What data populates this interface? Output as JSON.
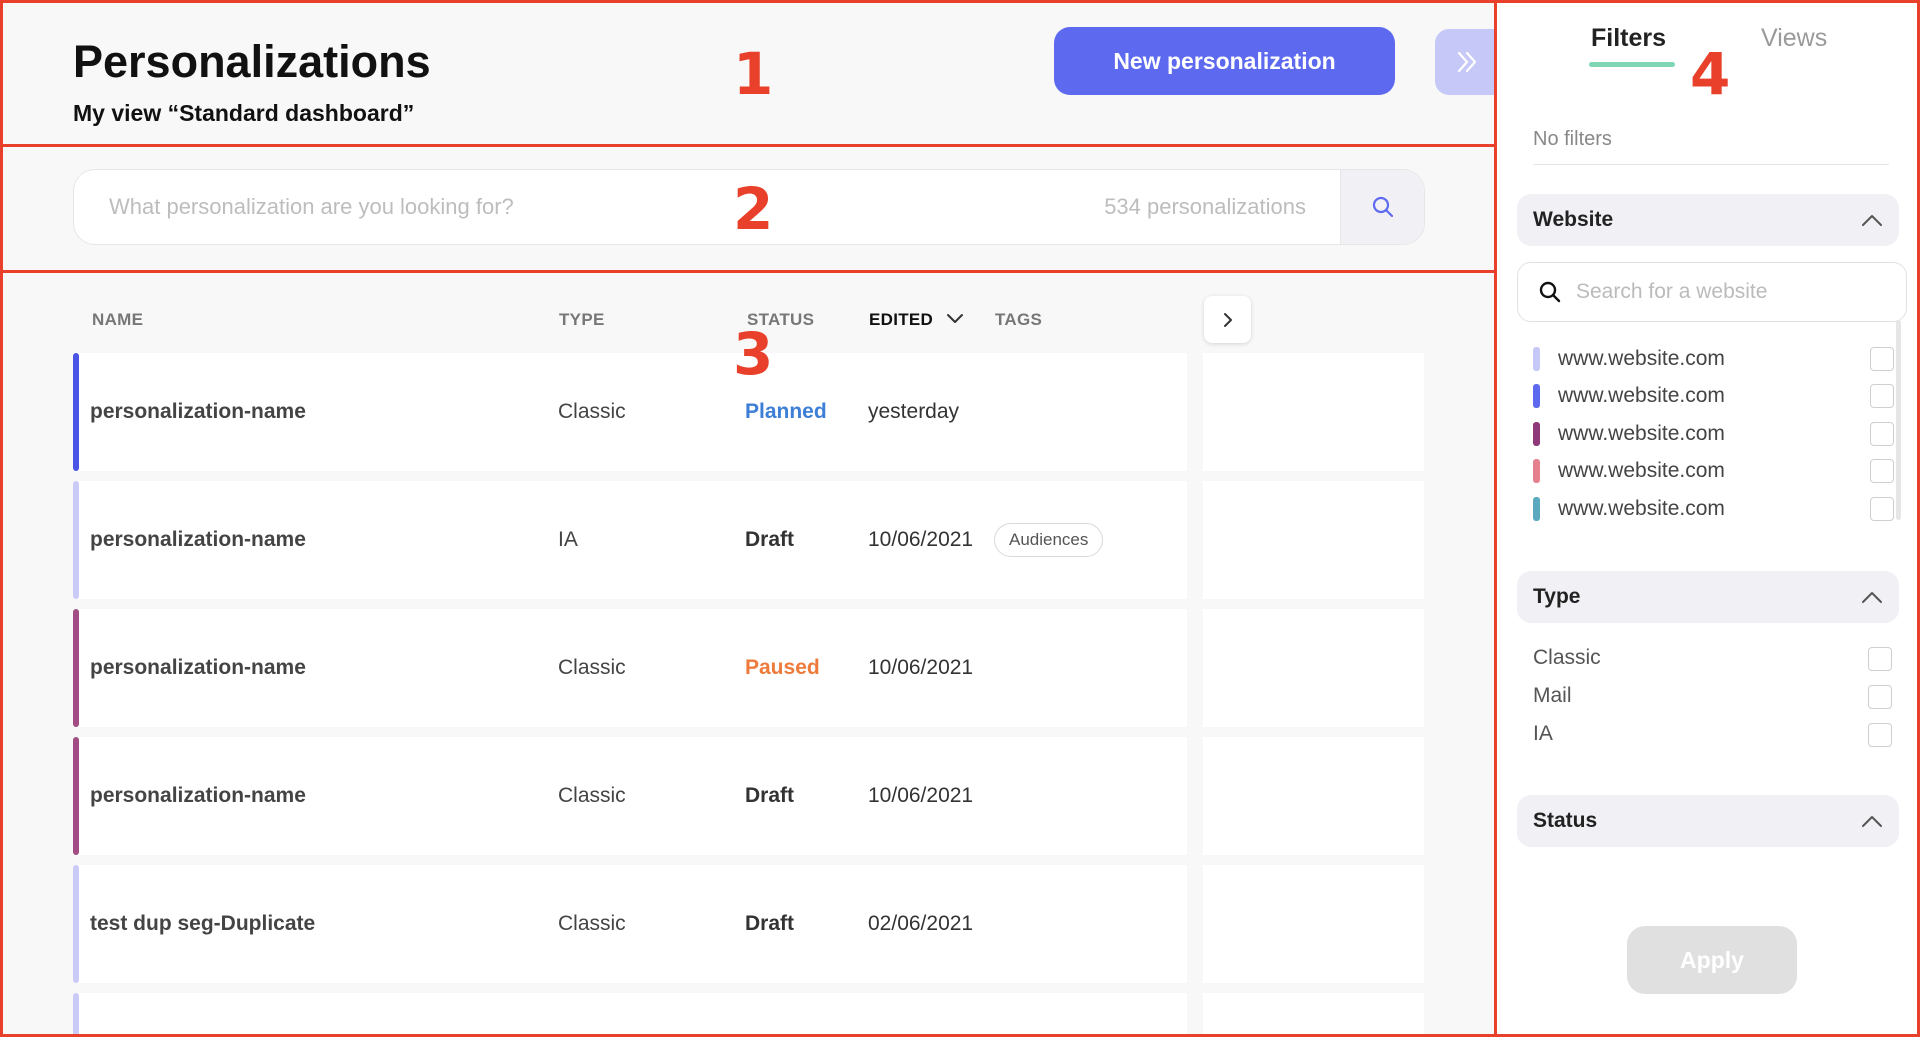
{
  "header": {
    "title": "Personalizations",
    "subtitle": "My view “Standard dashboard”",
    "new_button": "New personalization"
  },
  "search": {
    "placeholder": "What personalization are you looking for?",
    "count": "534 personalizations"
  },
  "table": {
    "columns": {
      "name": "NAME",
      "type": "TYPE",
      "status": "STATUS",
      "edited": "EDITED",
      "tags": "TAGS"
    },
    "rows": [
      {
        "name": "personalization-name",
        "type": "Classic",
        "status": "Planned",
        "edited": "yesterday",
        "tag": "",
        "accent": "#4a55e8",
        "status_color": "#3d7fd6"
      },
      {
        "name": "personalization-name",
        "type": "IA",
        "status": "Draft",
        "edited": "10/06/2021",
        "tag": "Audiences",
        "accent": "#c9cbf6",
        "status_color": "#333333"
      },
      {
        "name": "personalization-name",
        "type": "Classic",
        "status": "Paused",
        "edited": "10/06/2021",
        "tag": "",
        "accent": "#a24c86",
        "status_color": "#ee7b3b"
      },
      {
        "name": "personalization-name",
        "type": "Classic",
        "status": "Draft",
        "edited": "10/06/2021",
        "tag": "",
        "accent": "#a24c86",
        "status_color": "#333333"
      },
      {
        "name": "test dup seg-Duplicate",
        "type": "Classic",
        "status": "Draft",
        "edited": "02/06/2021",
        "tag": "",
        "accent": "#c9cbf6",
        "status_color": "#333333"
      }
    ]
  },
  "sidebar": {
    "tabs": {
      "filters": "Filters",
      "views": "Views"
    },
    "no_filters": "No filters",
    "website": {
      "title": "Website",
      "search_placeholder": "Search for a website",
      "items": [
        {
          "label": "www.website.com",
          "color": "#c6c8f8"
        },
        {
          "label": "www.website.com",
          "color": "#5d6af0"
        },
        {
          "label": "www.website.com",
          "color": "#8e3a7a"
        },
        {
          "label": "www.website.com",
          "color": "#e5808f"
        },
        {
          "label": "www.website.com",
          "color": "#5aa9c0"
        }
      ]
    },
    "type": {
      "title": "Type",
      "items": [
        "Classic",
        "Mail",
        "IA"
      ]
    },
    "status": {
      "title": "Status"
    },
    "apply": "Apply"
  },
  "annotations": [
    "1",
    "2",
    "3",
    "4"
  ]
}
